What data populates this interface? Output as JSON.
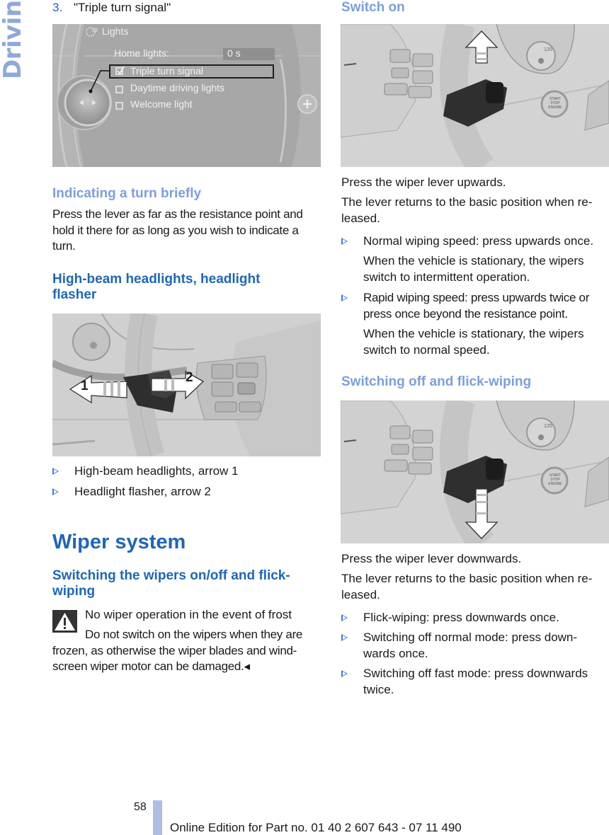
{
  "side_tab": "Driving",
  "left": {
    "step": {
      "number": "3.",
      "text": "\"Triple turn signal\""
    },
    "lights_screen": {
      "title": "Lights",
      "home_lights_label": "Home lights:",
      "home_lights_value": "0 s",
      "options": [
        {
          "label": "Triple turn signal",
          "checked": true,
          "selected": true
        },
        {
          "label": "Daytime driving lights",
          "checked": false,
          "selected": false
        },
        {
          "label": "Welcome light",
          "checked": false,
          "selected": false
        }
      ]
    },
    "indicating_heading": "Indicating a turn briefly",
    "indicating_text": "Press the lever as far as the resistance point and hold it there for as long as you wish to indicate a turn.",
    "highbeam_heading": "High-beam headlights, headlight flasher",
    "highbeam_figure": {
      "arrow1": "1",
      "arrow2": "2"
    },
    "highbeam_bullets": [
      "High-beam headlights, arrow 1",
      "Headlight flasher, arrow 2"
    ],
    "wiper_heading": "Wiper system",
    "switching_heading": "Switching the wipers on/off and flick-wiping",
    "warning_title": "No wiper operation in the event of frost",
    "warning_text": "Do not switch on the wipers when they are frozen, as otherwise the wiper blades and wind­screen wiper motor can be damaged.◂"
  },
  "right": {
    "switch_on_heading": "Switch on",
    "switch_on_p1": "Press the wiper lever upwards.",
    "switch_on_p2": "The lever returns to the basic position when re­leased.",
    "switch_on_bullets": [
      {
        "text": "Normal wiping speed: press upwards once.",
        "note": "When the vehicle is stationary, the wipers switch to intermittent operation."
      },
      {
        "text": "Rapid wiping speed: press upwards twice or press once beyond the resistance point.",
        "note": "When the vehicle is stationary, the wipers switch to normal speed."
      }
    ],
    "switch_off_heading": "Switching off and flick-wiping",
    "switch_off_p1": "Press the wiper lever downwards.",
    "switch_off_p2": "The lever returns to the basic position when re­leased.",
    "switch_off_bullets": [
      "Flick-wiping: press downwards once.",
      "Switching off normal mode: press down­wards once.",
      "Switching off fast mode: press downwards twice."
    ],
    "gauge_label": "120",
    "start_stop_label": "START STOP ENGINE"
  },
  "footer": {
    "page_number": "58",
    "edition": "Online Edition for Part no. 01 40 2 607 643 - 07 11 490"
  },
  "colors": {
    "heading_blue": "#1f66b8",
    "light_heading_blue": "#7b9fdc",
    "side_tab": "#8fa8dc",
    "footer_bar": "#aebde3"
  }
}
